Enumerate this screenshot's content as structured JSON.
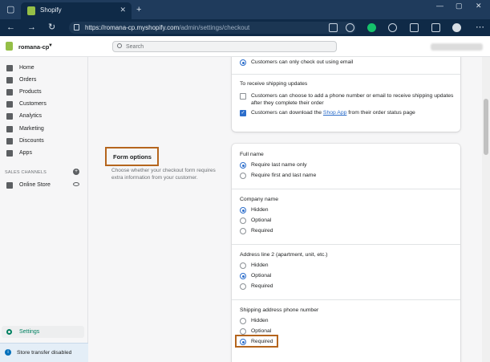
{
  "browser": {
    "tab_title": "Shopify",
    "url_host": "https://romana-cp.myshopify.com",
    "url_path": "/admin/settings/checkout"
  },
  "topbar": {
    "store_name": "romana-cp",
    "search_placeholder": "Search"
  },
  "sidebar": {
    "items": [
      {
        "label": "Home",
        "icon": "home-icon"
      },
      {
        "label": "Orders",
        "icon": "orders-icon"
      },
      {
        "label": "Products",
        "icon": "tag-icon"
      },
      {
        "label": "Customers",
        "icon": "person-icon"
      },
      {
        "label": "Analytics",
        "icon": "chart-icon"
      },
      {
        "label": "Marketing",
        "icon": "megaphone-icon"
      },
      {
        "label": "Discounts",
        "icon": "discount-icon"
      },
      {
        "label": "Apps",
        "icon": "apps-icon"
      }
    ],
    "sales_channels_label": "SALES CHANNELS",
    "online_store_label": "Online Store",
    "settings_label": "Settings",
    "store_transfer": "Store transfer disabled"
  },
  "contact": {
    "email_only": "Customers can only check out using email",
    "shipping_updates_title": "To receive shipping updates",
    "cb1_label_line1": "Customers can choose to add a phone number or email to receive shipping updates",
    "cb1_label_line2": "after they complete their order",
    "cb2_before": "Customers can download the ",
    "cb2_link": "Shop App",
    "cb2_after": " from their order status page"
  },
  "form_options": {
    "title": "Form options",
    "description": "Choose whether your checkout form requires extra information from your customer.",
    "full_name": {
      "label": "Full name",
      "options": [
        "Require last name only",
        "Require first and last name"
      ],
      "selected": 0
    },
    "company_name": {
      "label": "Company name",
      "options": [
        "Hidden",
        "Optional",
        "Required"
      ],
      "selected": 0
    },
    "address_line2": {
      "label": "Address line 2 (apartment, unit, etc.)",
      "options": [
        "Hidden",
        "Optional",
        "Required"
      ],
      "selected": 1
    },
    "phone": {
      "label": "Shipping address phone number",
      "options": [
        "Hidden",
        "Optional",
        "Required"
      ],
      "selected": 2
    }
  },
  "colors": {
    "accent": "#2c6ecb",
    "highlight": "#b5651d",
    "shopify_green": "#95bf47"
  }
}
